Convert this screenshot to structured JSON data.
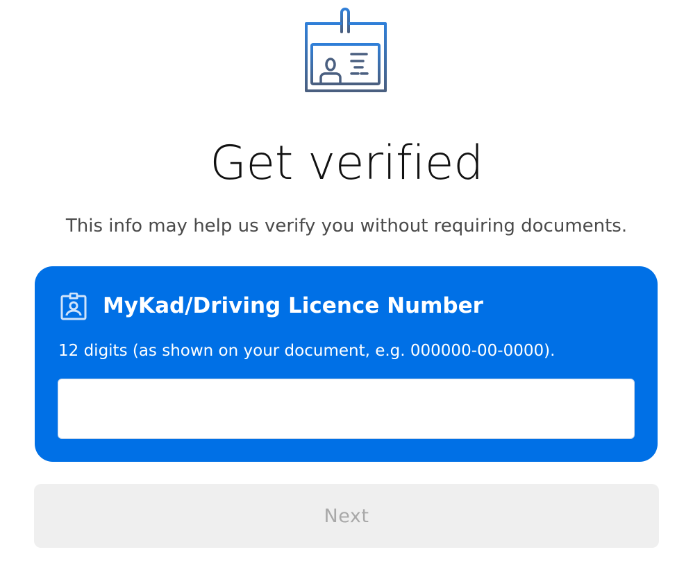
{
  "hero": {
    "icon": "id-badge-icon"
  },
  "page": {
    "title": "Get verified",
    "subtitle": "This info may help us verify you without requiring documents."
  },
  "card": {
    "icon": "id-card-icon",
    "heading": "MyKad/Driving Licence Number",
    "hint": "12 digits (as shown on your document, e.g. 000000-00-0000).",
    "input_value": ""
  },
  "actions": {
    "next_label": "Next"
  },
  "colors": {
    "card_background": "#0070e6",
    "button_disabled_background": "#efefef",
    "button_disabled_text": "#a9a9a9",
    "icon_blue": "#2f7fd8",
    "icon_slate": "#4a5f80"
  }
}
